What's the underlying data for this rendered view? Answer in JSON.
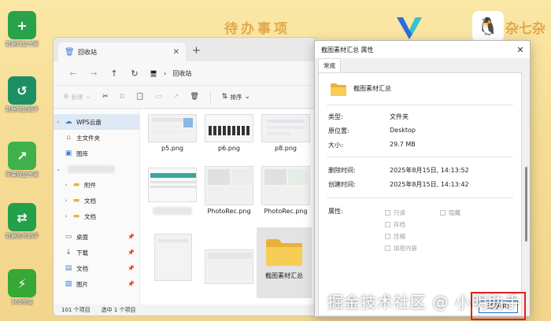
{
  "desktop": {
    "banner": "待办事项",
    "banner_right": "杂七杂",
    "icons": [
      {
        "label": "数据恢复专家",
        "color": "#2aa24b",
        "glyph": "+"
      },
      {
        "label": "数据恢复助手",
        "color": "#1d8f64",
        "glyph": "↺"
      },
      {
        "label": "苹果恢复专家",
        "color": "#3fb14b",
        "glyph": "↗"
      },
      {
        "label": "数据互传助手",
        "color": "#23a04a",
        "glyph": "⇄"
      },
      {
        "label": "360杀毒",
        "color": "#36a836",
        "glyph": "⚡"
      }
    ]
  },
  "explorer": {
    "tab_title": "回收站",
    "address": "回收站",
    "toolbar": {
      "new_label": "新建",
      "sort_label": "排序"
    },
    "sidebar": [
      {
        "label": "WPS云盘",
        "icon": "cloud-icon"
      },
      {
        "label": "主文件夹",
        "icon": "home-icon"
      },
      {
        "label": "图库",
        "icon": "gallery-icon"
      },
      {
        "label": "附件",
        "icon": "folder-icon"
      },
      {
        "label": "文档",
        "icon": "folder-icon"
      },
      {
        "label": "文档",
        "icon": "folder-icon"
      },
      {
        "label": "桌面",
        "icon": "desktop-icon"
      },
      {
        "label": "下载",
        "icon": "download-icon"
      },
      {
        "label": "文档",
        "icon": "document-icon"
      },
      {
        "label": "图片",
        "icon": "picture-icon"
      }
    ],
    "files": [
      "p5.png",
      "p6.png",
      "p8.png",
      "PhotoRec.png",
      "PhotoRec.png",
      "截图素材汇总"
    ],
    "status_count": "101 个项目",
    "status_selected": "选中 1 个项目"
  },
  "properties": {
    "title": "截图素材汇总 属性",
    "tab": "常规",
    "name": "截图素材汇总",
    "type_label": "类型:",
    "type_value": "文件夹",
    "location_label": "原位置:",
    "location_value": "Desktop",
    "size_label": "大小:",
    "size_value": "29.7 MB",
    "deleted_label": "删除时间:",
    "deleted_value": "2025年8月15日, 14:13:52",
    "created_label": "创建时间:",
    "created_value": "2025年8月15日, 14:13:42",
    "attributes_label": "属性:",
    "attr_readonly": "只读",
    "attr_hidden": "隐藏",
    "attr_archive": "存档",
    "attr_compress": "压缩",
    "attr_encrypt": "加密内容",
    "restore_label": "还原(R)"
  },
  "watermark": "掘金技术社区 @ 小明助手",
  "colors": {
    "highlight": "#e02020",
    "accent": "#1f6fd1"
  }
}
